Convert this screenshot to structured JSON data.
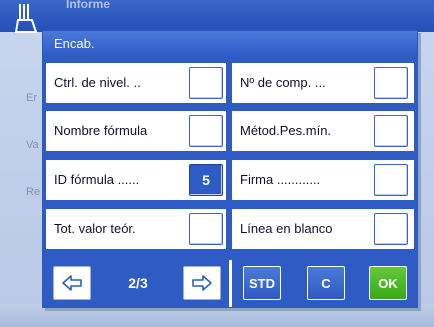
{
  "background": {
    "app_title": "Informe",
    "rows": [
      "Er",
      "Va",
      "Re"
    ]
  },
  "dialog": {
    "title": "Encab.",
    "left_column": [
      {
        "label": "Ctrl. de nivel. ..",
        "value": ""
      },
      {
        "label": "Nombre fórmula",
        "value": ""
      },
      {
        "label": "ID fórmula ......",
        "value": "5"
      },
      {
        "label": "Tot. valor teór.",
        "value": ""
      }
    ],
    "right_column": [
      {
        "label": "Nº de comp. ...",
        "value": ""
      },
      {
        "label": "Métod.Pes.mín.",
        "value": ""
      },
      {
        "label": "Firma ............",
        "value": ""
      },
      {
        "label": "Línea en blanco",
        "value": ""
      }
    ],
    "footer": {
      "prev_icon": "left-arrow-icon",
      "page_indicator": "2/3",
      "next_icon": "right-arrow-icon",
      "std_label": "STD",
      "c_label": "C",
      "ok_label": "OK"
    }
  },
  "colors": {
    "accent_blue": "#2f5bc4",
    "ok_green": "#3aa81a"
  }
}
